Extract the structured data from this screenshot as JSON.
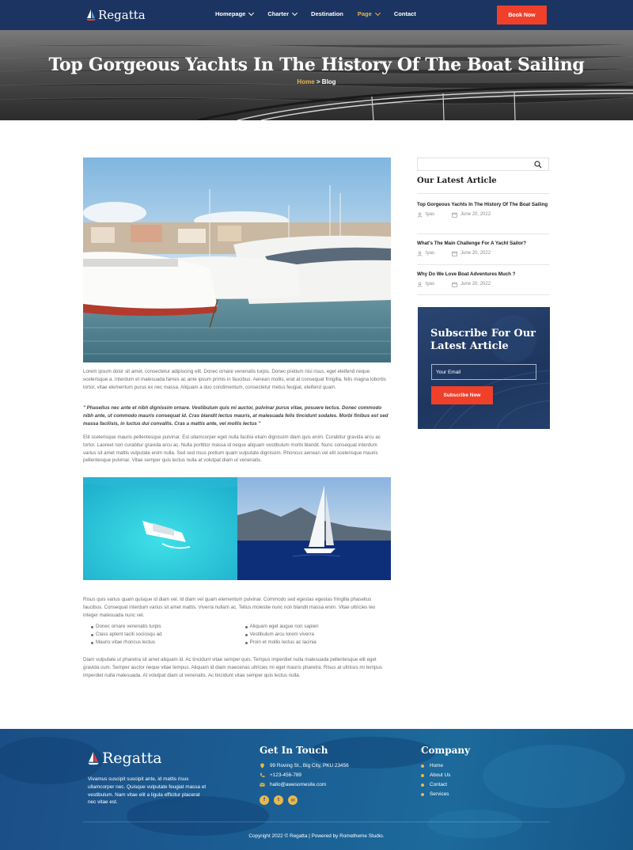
{
  "brand": {
    "name": "Regatta"
  },
  "nav": {
    "items": [
      {
        "label": "Homepage",
        "has_dropdown": true,
        "active": false
      },
      {
        "label": "Charter",
        "has_dropdown": true,
        "active": false
      },
      {
        "label": "Destination",
        "has_dropdown": false,
        "active": false
      },
      {
        "label": "Page",
        "has_dropdown": true,
        "active": true
      },
      {
        "label": "Contact",
        "has_dropdown": false,
        "active": false
      }
    ],
    "cta_label": "Book Now"
  },
  "hero": {
    "title": "Top Gorgeous Yachts In The History Of The Boat Sailing",
    "breadcrumb": {
      "home": "Home",
      "separator": ">",
      "current": "Blog"
    }
  },
  "article": {
    "paragraph_1": "Lorem ipsum dolor sit amet, consectetur adipiscing elit. Donec ornare venenatis turpis. Donec pretium nisi risus, eget eleifend neque scelerisque a. Interdum et malesuada fames ac ante ipsum primis in faucibus. Aenean mollis, erat at consequat fringilla, felis magna lobortis tortor, vitae elementum purus ex nec massa. Aliquam a duo condimentum, consectetur metus feugiat, eleifend quam.",
    "quote": "\" Phasellus nec ante et nibh dignissim ornare. Vestibulum quis mi auctor, pulvinar purus vitae, posuere lectus. Donec commodo nibh ante, ut commodo mauris consequat id. Cras blandit lectus mauris, at malesuada felis tincidunt sodales. Morbi finibus est sed massa facilisis, in luctus dui convallis. Cras a mattis ante, vel mollis lectus \"",
    "paragraph_2": "Elit scelerisque mauris pellentesque pulvinar. Est ullamcorper eget nulla facilisi etiam dignissim diam quis enim. Curabitur gravida arcu ac tortor. Laoreet non curabitur gravida arcu ac. Nulla porttitor massa id neque aliquam vestibulum morbi blandit. Nunc consequat interdum varius sit amet mattis vulputate enim nulla. Sed sed risus pretium quam vulputate dignissim. Rhoncus aenean vel elit scelerisque mauris pellentesque pulvinar. Vitae semper quis lectus nulla at volutpat diam ut venenatis.",
    "paragraph_3": "Risus quis varius quam quisque id diam vel. Id diam vel quam elementum pulvinar. Commodo sed egestas egestas fringilla phasellus faucibus. Consequat interdum varius sit amet mattis. Viverra nullam ac. Tellus molestie nunc non blandit massa enim. Vitae ultricies leo integer malesuada nunc vel.",
    "list_left": [
      "Donec ornare venenatis turpis",
      "Class aptent taciti sociosqu ad",
      "Mauris vitae rhoncus lectus"
    ],
    "list_right": [
      "Aliquam eget augue non sapien",
      "Vestibulum arcu lorem viverra",
      "Proin et mollis lectus ac lacinia"
    ],
    "paragraph_4": "Diam vulputate ut pharetra sit amet aliquam id. Ac tincidunt vitae semper quis. Tempus imperdiet nulla malesuada pellentesque elit eget gravida cum. Semper auctor neque vitae tempus. Aliquam id diam maecenas ultricies mi eget mauris pharetra. Risus at ultrices mi tempus imperdiet nulla malesuada. At volutpat diam ut venenatis. Ac tincidunt vitae semper quis lectus nulla."
  },
  "sidebar": {
    "search": {
      "placeholder": ""
    },
    "latest_title": "Our Latest Article",
    "latest": [
      {
        "title": "Top Gorgeous Yachts In The History Of The Boat Sailing",
        "author": "tyas",
        "date": "June 20, 2022"
      },
      {
        "title": "What's The Main Challenge For A Yacht Sailor?",
        "author": "tyas",
        "date": "June 20, 2022"
      },
      {
        "title": "Why Do We Love Boat Adventures Much ?",
        "author": "tyas",
        "date": "June 20, 2022"
      }
    ],
    "subscribe": {
      "title": "Subscribe For Our Latest Article",
      "email_placeholder": "Your Email",
      "button": "Subscribe Now"
    }
  },
  "footer": {
    "brand": "Regatta",
    "about": "Vivamus suscipit suscipit ante, id mattis risus ullamcorper nec. Quisque vulputate feugiat massa et vestibulum. Nam vitae elit a ligula efficitur placerat nec vitae est.",
    "contact_title": "Get In Touch",
    "address": "99 Roving St., Big City, PKU 23456",
    "phone": "+123-456-789",
    "email": "hallo@awesomesite.com",
    "company_title": "Company",
    "company_links": [
      "Home",
      "About Us",
      "Contact",
      "Services"
    ],
    "copyright": "Copyright 2022 © Regatta | Powered by Rometheme Studio."
  },
  "colors": {
    "navy": "#1c3461",
    "accent_red": "#f0402a",
    "gold": "#e8b64c"
  }
}
